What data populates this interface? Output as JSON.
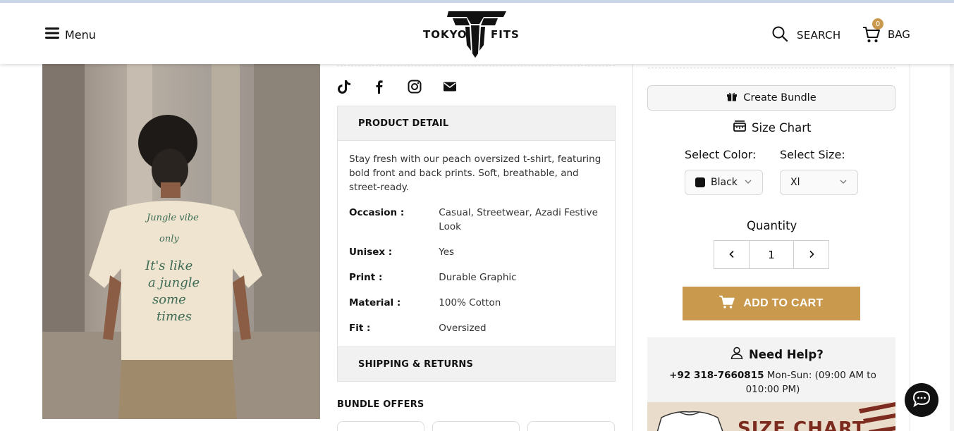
{
  "header": {
    "menu_label": "Menu",
    "brand_left": "TOKYO",
    "brand_right": "FITS",
    "search_label": "SEARCH",
    "bag_label": "BAG",
    "bag_count": "0"
  },
  "product_image": {
    "print_line1": "Jungle vibe",
    "print_line2": "only",
    "print_line3": "It's like",
    "print_line4": "a jungle",
    "print_line5": "some",
    "print_line6": "times"
  },
  "social": [
    "tiktok-icon",
    "facebook-icon",
    "instagram-icon",
    "email-icon"
  ],
  "product_detail": {
    "heading": "PRODUCT DETAIL",
    "description": "Stay fresh with our peach oversized t-shirt, featuring bold front and back prints. Soft, breathable, and street-ready.",
    "rows": [
      {
        "key": "Occasion :",
        "value": "Casual, Streetwear, Azadi Festive Look"
      },
      {
        "key": "Unisex :",
        "value": "Yes"
      },
      {
        "key": "Print :",
        "value": "Durable Graphic"
      },
      {
        "key": "Material :",
        "value": "100% Cotton"
      },
      {
        "key": "Fit :",
        "value": "Oversized"
      }
    ]
  },
  "shipping": {
    "heading": "SHIPPING & RETURNS"
  },
  "bundle_offers": {
    "heading": "BUNDLE OFFERS"
  },
  "purchase": {
    "create_bundle_label": "Create Bundle",
    "size_chart_label": "Size Chart",
    "color_label": "Select Color:",
    "color_value": "Black",
    "size_label": "Select Size:",
    "size_value": "Xl",
    "quantity_label": "Quantity",
    "quantity_value": "1",
    "add_to_cart_label": "ADD TO CART",
    "accent_color": "#c99a4e"
  },
  "help": {
    "title": "Need Help?",
    "phone": "+92 318-7660815",
    "hours": "Mon-Sun: (09:00 AM to 010:00 PM)"
  },
  "size_banner": {
    "text": "SIZE CHART"
  }
}
